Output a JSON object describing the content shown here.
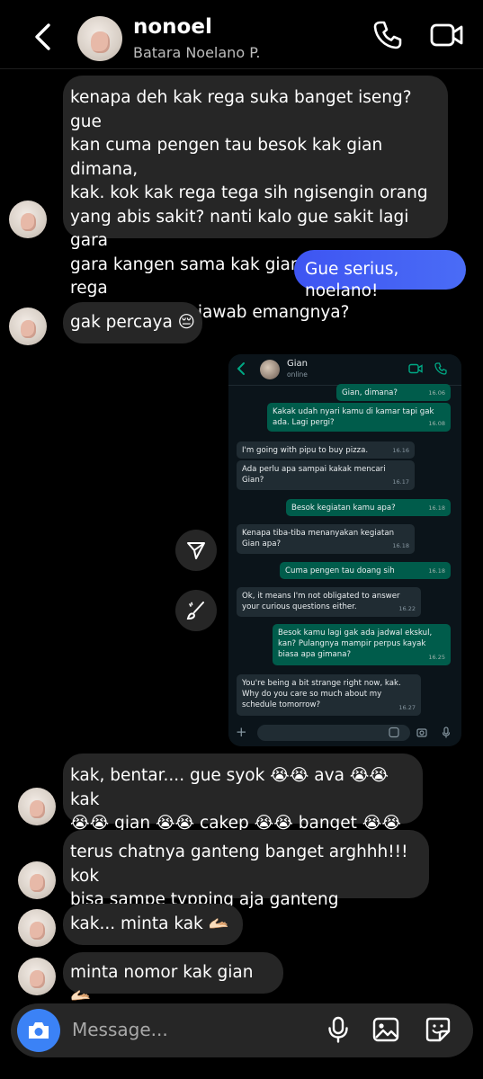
{
  "header": {
    "display_name": "nonoel",
    "username": "Batara Noelano P."
  },
  "messages": [
    {
      "side": "received",
      "text": "kenapa deh kak rega suka banget iseng? gue\nkan cuma pengen tau besok kak gian dimana,\nkak. kok kak rega tega sih ngisengin orang\nyang abis sakit? nanti kalo gue sakit lagi gara\ngara kangen sama kak gian gimana? kak rega\nmau tanggung jawab emangnya?"
    },
    {
      "side": "sent",
      "text": "Gue serius, noelano!"
    },
    {
      "side": "received",
      "text": "gak percaya 😔"
    },
    {
      "side": "received",
      "text": "kak, bentar.... gue syok 😭😭 ava 😭😭 kak\n😭😭 gian 😭😭 cakep 😭😭 banget 😭😭 woy"
    },
    {
      "side": "received",
      "text": "terus chatnya ganteng banget arghhh!!! kok\nbisa sampe typping aja ganteng huhuhuhu"
    },
    {
      "side": "received",
      "text": "kak... minta kak 🫴🏻"
    },
    {
      "side": "received",
      "text": "minta nomor kak gian 🫴🏻"
    }
  ],
  "screenshot": {
    "contact_name": "Gian",
    "status": "online",
    "messages": [
      {
        "side": "out",
        "text": "Gian, dimana?",
        "time": "16.06"
      },
      {
        "side": "out",
        "text": "Kakak udah nyari kamu di kamar tapi gak\nada. Lagi pergi?",
        "time": "16.08"
      },
      {
        "side": "in",
        "text": "I'm going with pipu to buy pizza.",
        "time": "16.16"
      },
      {
        "side": "in",
        "text": "Ada perlu apa sampai kakak mencari\nGian?",
        "time": "16.17"
      },
      {
        "side": "out",
        "text": "Besok kegiatan kamu apa?",
        "time": "16.18"
      },
      {
        "side": "in",
        "text": "Kenapa tiba-tiba menanyakan kegiatan\nGian apa?",
        "time": "16.18"
      },
      {
        "side": "out",
        "text": "Cuma pengen tau doang sih",
        "time": "16.18"
      },
      {
        "side": "in",
        "text": "Ok, it means I'm not obligated to answer\nyour curious questions either.",
        "time": "16.22"
      },
      {
        "side": "out",
        "text": "Besok kamu lagi gak ada jadwal ekskul,\nkan? Pulangnya mampir perpus kayak\nbiasa apa gimana?",
        "time": "16.25"
      },
      {
        "side": "in",
        "text": "You're being a bit strange right now, kak.\nWhy do you care so much about my\nschedule tomorrow?",
        "time": "16.27"
      }
    ]
  },
  "composer": {
    "placeholder": "Message..."
  },
  "colors": {
    "sent_bubble": "#3e55f2",
    "received_bubble": "#262626",
    "camera_button": "#3b82f6",
    "wa_outgoing": "#005c4b",
    "wa_incoming": "#202c33"
  },
  "icons": [
    "back-arrow-icon",
    "phone-icon",
    "video-camera-icon",
    "share-icon",
    "brush-icon",
    "camera-icon",
    "microphone-icon",
    "gallery-icon",
    "sticker-icon"
  ]
}
